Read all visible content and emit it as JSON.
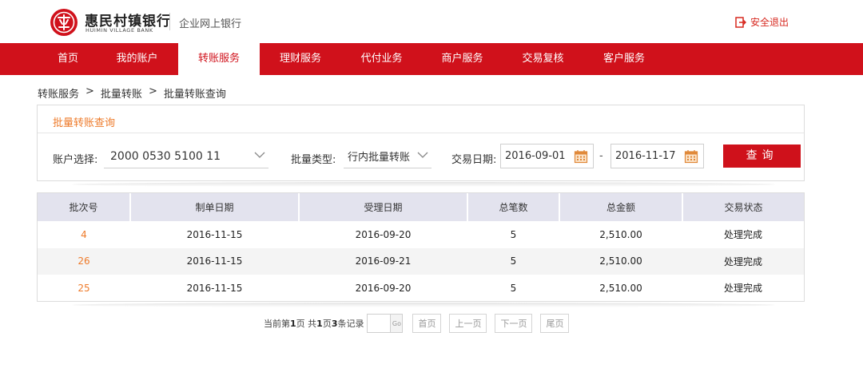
{
  "header": {
    "bank_name": "惠民村镇银行",
    "bank_name_en": "HUIMIN VILLAGE BANK",
    "subtitle": "企业网上银行",
    "logout_label": "安全退出",
    "brand_color": "#d0111b"
  },
  "nav": {
    "items": [
      {
        "label": "首页"
      },
      {
        "label": "我的账户"
      },
      {
        "label": "转账服务",
        "active": true
      },
      {
        "label": "理财服务"
      },
      {
        "label": "代付业务"
      },
      {
        "label": "商户服务"
      },
      {
        "label": "交易复核"
      },
      {
        "label": "客户服务"
      }
    ]
  },
  "breadcrumb": {
    "level1": "转账服务",
    "sep": ">",
    "level2": "批量转账",
    "level3": "批量转账查询"
  },
  "query": {
    "title": "批量转账查询",
    "account_label": "账户选择:",
    "account_value": "2000 0530 5100 11",
    "type_label": "批量类型:",
    "type_value": "行内批量转账",
    "date_label": "交易日期:",
    "date_from": "2016-09-01",
    "date_sep": "-",
    "date_to": "2016-11-17",
    "button_label": "查询"
  },
  "table": {
    "columns": [
      "批次号",
      "制单日期",
      "受理日期",
      "总笔数",
      "总金额",
      "交易状态"
    ],
    "rows": [
      [
        "4",
        "2016-11-15",
        "2016-09-20",
        "5",
        "2,510.00",
        "处理完成"
      ],
      [
        "26",
        "2016-11-15",
        "2016-09-21",
        "5",
        "2,510.00",
        "处理完成"
      ],
      [
        "25",
        "2016-11-15",
        "2016-09-20",
        "5",
        "2,510.00",
        "处理完成"
      ]
    ]
  },
  "pager": {
    "t1": "当前第",
    "current_page": "1",
    "t2": "页 共",
    "total_pages": "1",
    "t3": "页",
    "total_records": "3",
    "t4": "条记录",
    "go_label": "Go",
    "first_label": "首页",
    "prev_label": "上一页",
    "next_label": "下一页",
    "last_label": "尾页"
  }
}
